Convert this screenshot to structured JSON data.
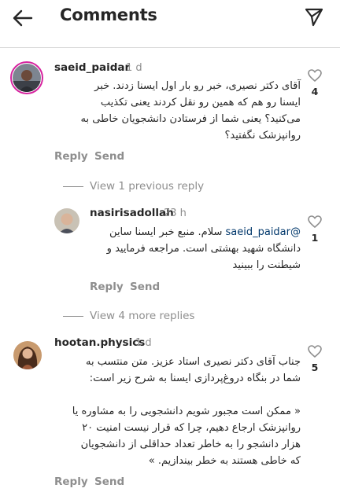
{
  "header": {
    "title": "Comments"
  },
  "comments": [
    {
      "username": "saeid_paidar",
      "time": "1 d",
      "lines": [
        "آقای دکتر نصیری، خبر رو بار اول ایسنا زدند. خبر",
        "ایسنا رو هم که همین رو نقل کردند یعنی تکذیب",
        "می‌کنید؟ یعنی شما از فرستادن دانشجویان خاطی به",
        "روانپزشک نگفتید؟"
      ],
      "likes": "4",
      "reply_label": "Reply",
      "send_label": "Send",
      "view_previous": "View 1 previous reply"
    },
    {
      "username": "nasirisadollah",
      "time": "23 h",
      "mention": "@saeid_paidar",
      "lines": [
        "سلام. منبع خبر ایسنا ساین",
        "دانشگاه شهید بهشتی است. مراجعه فرمایید و",
        "شیطنت را ببینید"
      ],
      "likes": "1",
      "reply_label": "Reply",
      "send_label": "Send",
      "view_more": "View 4 more replies"
    },
    {
      "username": "hootan.physics",
      "time": "1 d",
      "lines": [
        "جناب آقای دکتر نصیری استاد عزیز. متن منتسب به",
        "شما در بنگاه دروغ‌پردازی ایسنا به شرح زیر است:",
        "",
        "« ممکن است مجبور شویم دانشجویی را به مشاوره یا",
        "روانپزشک ارجاع دهیم، چرا که قرار نیست امنیت ۲۰",
        "هزار دانشجو را به خاطر تعداد حداقلی از دانشجویان",
        "که خاطی هستند به خطر بیندازیم. »"
      ],
      "likes": "5",
      "reply_label": "Reply",
      "send_label": "Send"
    }
  ]
}
